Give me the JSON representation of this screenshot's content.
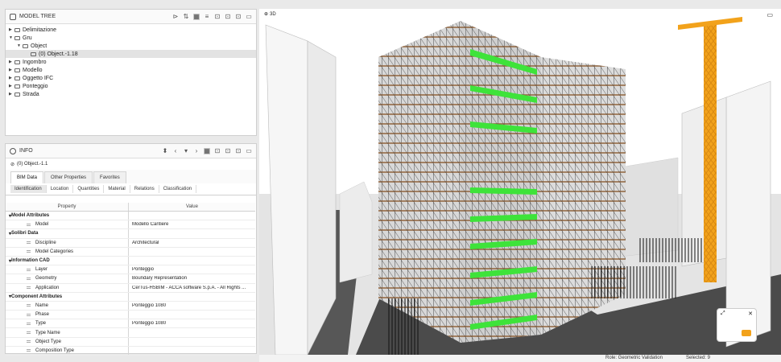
{
  "model_tree": {
    "title": "MODEL TREE",
    "items": [
      {
        "label": "Delimitazione",
        "depth": 0,
        "expanded": false
      },
      {
        "label": "Gru",
        "depth": 0,
        "expanded": true
      },
      {
        "label": "Object",
        "depth": 1,
        "expanded": true
      },
      {
        "label": "(0) Object.-1.18",
        "depth": 2,
        "selected": true
      },
      {
        "label": "Ingombro",
        "depth": 0,
        "expanded": false
      },
      {
        "label": "Modello",
        "depth": 0,
        "expanded": false
      },
      {
        "label": "Oggetto IFC",
        "depth": 0,
        "expanded": false
      },
      {
        "label": "Ponteggio",
        "depth": 0,
        "expanded": false
      },
      {
        "label": "Strada",
        "depth": 0,
        "expanded": false
      }
    ]
  },
  "info": {
    "title": "INFO",
    "object": "(0) Object.-1.1",
    "tabs": [
      "BIM Data",
      "Other Properties",
      "Favorites"
    ],
    "subtabs": [
      "Identification",
      "Location",
      "Quantities",
      "Material",
      "Relations",
      "Classification"
    ],
    "col_property": "Property",
    "col_value": "Value",
    "rows": [
      {
        "group": true,
        "p": "Model Attributes"
      },
      {
        "p": "Model",
        "v": "Modello Cantiere"
      },
      {
        "group": true,
        "p": "Solibri Data"
      },
      {
        "p": "Discipline",
        "v": "Architectural"
      },
      {
        "p": "Model Categories",
        "v": ""
      },
      {
        "group": true,
        "p": "Information CAD"
      },
      {
        "p": "Layer",
        "v": "Ponteggio"
      },
      {
        "p": "Geometry",
        "v": "Boundary Representation"
      },
      {
        "p": "Application",
        "v": "CerTus-HSBIM - ACCA software S.p.A. - All Rights ..."
      },
      {
        "group": true,
        "p": "Component Attributes"
      },
      {
        "p": "Name",
        "v": "Ponteggio 1080"
      },
      {
        "p": "Phase",
        "v": ""
      },
      {
        "p": "Type",
        "v": "Ponteggio 1080"
      },
      {
        "p": "Type Name",
        "v": ""
      },
      {
        "p": "Object Type",
        "v": ""
      },
      {
        "p": "Composition Type",
        "v": ""
      }
    ]
  },
  "viewport": {
    "title": "3D"
  },
  "status": {
    "role": "Role: Geometric Validation",
    "selected": "Selected: 9"
  },
  "colors": {
    "highlight": "#3ee33a",
    "crane": "#f2a21b",
    "scaffold_board": "#9a6a3f",
    "ground": "#4b4b4b"
  }
}
